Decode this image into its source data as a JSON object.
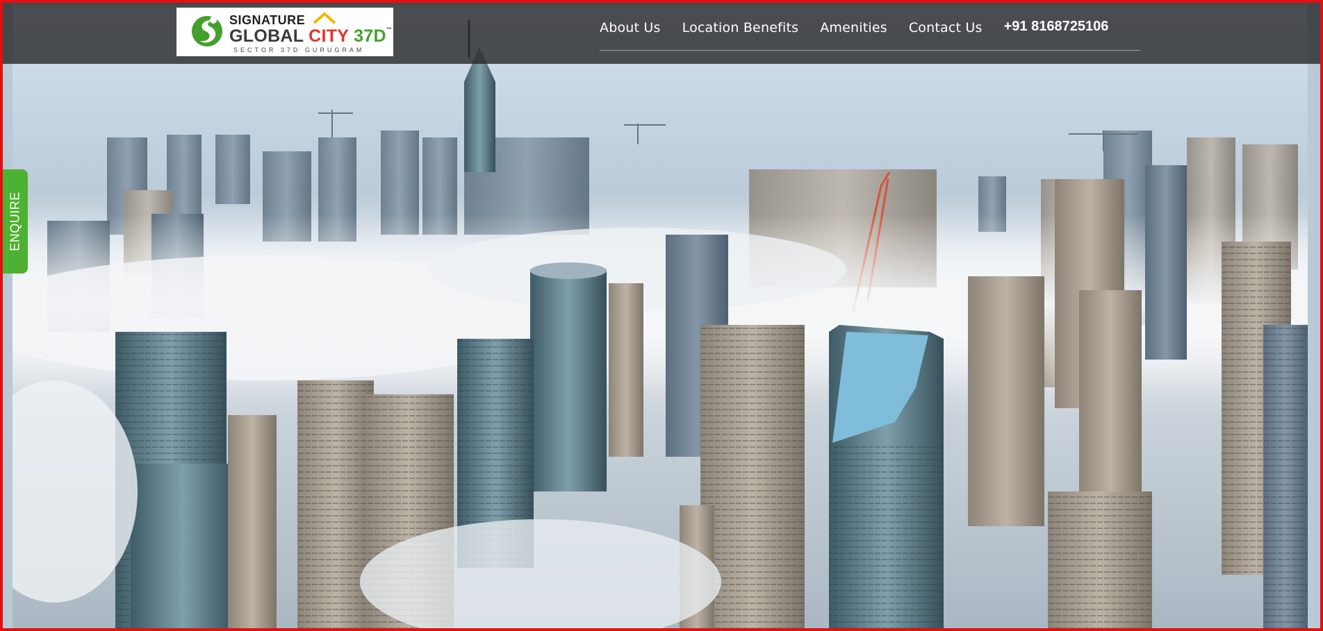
{
  "logo": {
    "line1": "SIGNATURE",
    "global": "GLOBAL",
    "city": "CITY",
    "num": "37D",
    "tm": "™",
    "subtitle": "SECTOR 37D GURUGRAM"
  },
  "nav": {
    "items": [
      "About Us",
      "Location Benefits",
      "Amenities",
      "Contact Us"
    ],
    "phone": "+91 8168725106"
  },
  "enquire": {
    "label": "ENQUIRE"
  },
  "colors": {
    "border": "#e41010",
    "topbar": "#222222",
    "enquire": "#4db131",
    "logo_green": "#43a02b",
    "logo_red": "#e4322b"
  },
  "hero": {
    "image": "foggy-city-skyline"
  }
}
